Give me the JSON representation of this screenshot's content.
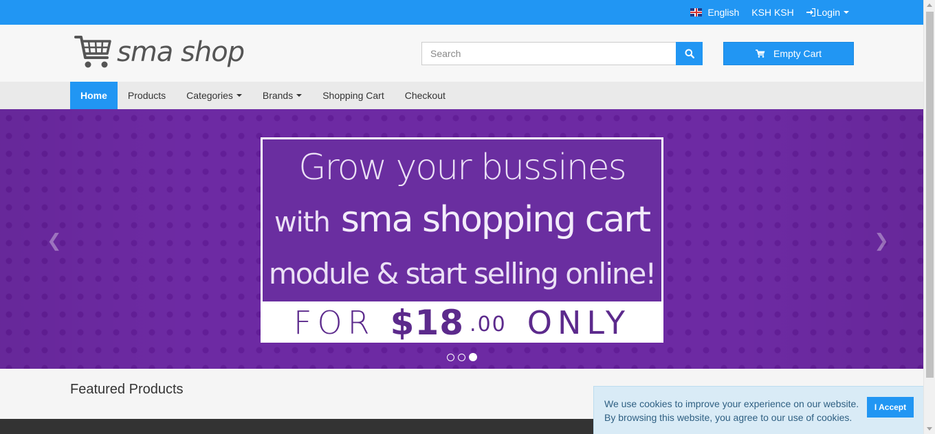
{
  "topbar": {
    "language": "English",
    "currency": "KSH KSH",
    "login": "Login"
  },
  "header": {
    "logo_text": "sma shop",
    "search_placeholder": "Search",
    "cart_label": "Empty Cart"
  },
  "nav": {
    "items": [
      {
        "label": "Home",
        "active": true
      },
      {
        "label": "Products"
      },
      {
        "label": "Categories",
        "dropdown": true
      },
      {
        "label": "Brands",
        "dropdown": true
      },
      {
        "label": "Shopping Cart"
      },
      {
        "label": "Checkout"
      }
    ]
  },
  "banner": {
    "line1": "Grow your bussines",
    "line2_prefix": "with",
    "line2_main": "sma shopping cart",
    "line3": "module & start selling online!",
    "for_text": "FOR",
    "price": "$18",
    "cents": ".00",
    "only_text": "ONLY",
    "active_slide": 3,
    "slide_count": 3
  },
  "featured": {
    "title": "Featured Products"
  },
  "cookie": {
    "line1": "We use cookies to improve your experience on our website.",
    "line2": "By browsing this website, you agree to our use of cookies.",
    "accept_label": "I Accept"
  },
  "colors": {
    "primary": "#2196f3",
    "banner_purple": "#6d2aa3",
    "cookie_bg": "#d9ebf6"
  }
}
